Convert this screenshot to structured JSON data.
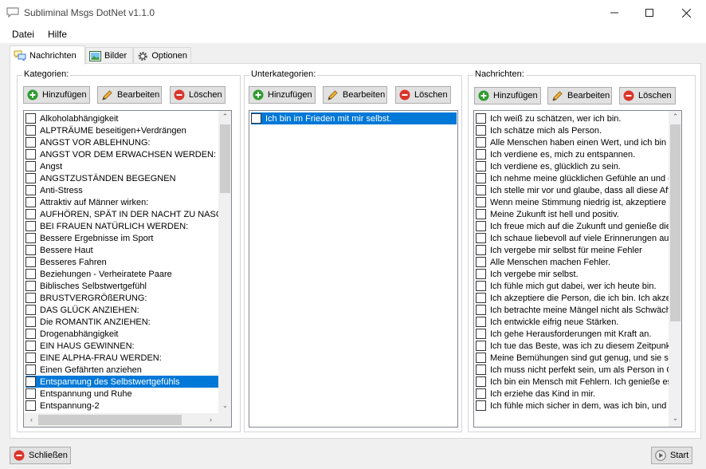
{
  "window": {
    "title": "Subliminal Msgs DotNet v1.1.0"
  },
  "menu": {
    "file": "Datei",
    "help": "Hilfe"
  },
  "tabs": [
    {
      "label": "Nachrichten"
    },
    {
      "label": "Bilder"
    },
    {
      "label": "Optionen"
    }
  ],
  "buttons": {
    "add": "Hinzufügen",
    "edit": "Bearbeiten",
    "delete": "Löschen"
  },
  "categories": {
    "label": "Kategorien:",
    "items": [
      "Alkoholabhängigkeit",
      "ALPTRÄUME beseitigen+Verdrängen",
      "ANGST VOR ABLEHNUNG:",
      "ANGST VOR DEM ERWACHSEN WERDEN:",
      "Angst",
      "ANGSTZUSTÄNDEN BEGEGNEN",
      "Anti-Stress",
      "Attraktiv auf Männer wirken:",
      "AUFHÖREN, SPÄT IN DER NACHT ZU NASC",
      "BEI FRAUEN NATÜRLICH WERDEN:",
      "Bessere Ergebnisse im Sport",
      "Bessere Haut",
      "Besseres Fahren",
      "Beziehungen - Verheiratete Paare",
      "Biblisches Selbstwertgefühl",
      "BRUSTVERGRÖßERUNG:",
      "DAS GLÜCK ANZIEHEN:",
      "Die ROMANTIK ANZIEHEN:",
      "Drogenabhängigkeit",
      "EIN HAUS GEWINNEN:",
      "EINE ALPHA-FRAU WERDEN:",
      "Einen Gefährten anziehen",
      "Entspannung des Selbstwertgefühls",
      "Entspannung und Ruhe",
      "Entspannung-2"
    ],
    "selected_index": 22
  },
  "subcategories": {
    "label": "Unterkategorien:",
    "items": [
      "Ich bin im Frieden mit mir selbst."
    ],
    "selected_index": 0
  },
  "messages": {
    "label": "Nachrichten:",
    "items": [
      "Ich weiß zu schätzen, wer ich bin.",
      "Ich schätze mich als Person.",
      "Alle Menschen haben einen Wert, und ich bin e",
      "Ich verdiene es, mich zu entspannen.",
      "Ich verdiene es, glücklich zu sein.",
      "Ich nehme meine glücklichen Gefühle an und ge",
      "Ich stelle mir vor und glaube, dass all diese Affir",
      "Wenn meine Stimmung niedrig ist, akzeptiere ich",
      "Meine Zukunft ist hell und positiv.",
      "Ich freue mich auf die Zukunft und genieße die",
      "Ich schaue liebevoll auf viele Erinnerungen aus",
      "Ich vergebe mir selbst für meine Fehler",
      "Alle Menschen machen Fehler.",
      "Ich vergebe mir selbst.",
      "Ich fühle mich gut dabei, wer ich heute bin.",
      "Ich akzeptiere die Person, die ich bin. Ich akzep",
      "Ich betrachte meine Mängel nicht als Schwäche",
      "Ich entwickle eifrig neue Stärken.",
      "Ich gehe Herausforderungen mit Kraft an.",
      "Ich tue das Beste, was ich zu diesem Zeitpunkt",
      "Meine Bemühungen sind gut genug, und sie sin",
      "Ich muss nicht perfekt sein, um als Person in Or",
      "Ich bin ein Mensch mit Fehlern. Ich genieße es,",
      "Ich erziehe das Kind in mir.",
      "Ich fühle mich sicher in dem, was ich bin, und bi"
    ]
  },
  "footer": {
    "close": "Schließen",
    "start": "Start"
  },
  "colors": {
    "selection": "#0078d7",
    "add_green": "#2e9b2e",
    "delete_red": "#d9352a"
  }
}
